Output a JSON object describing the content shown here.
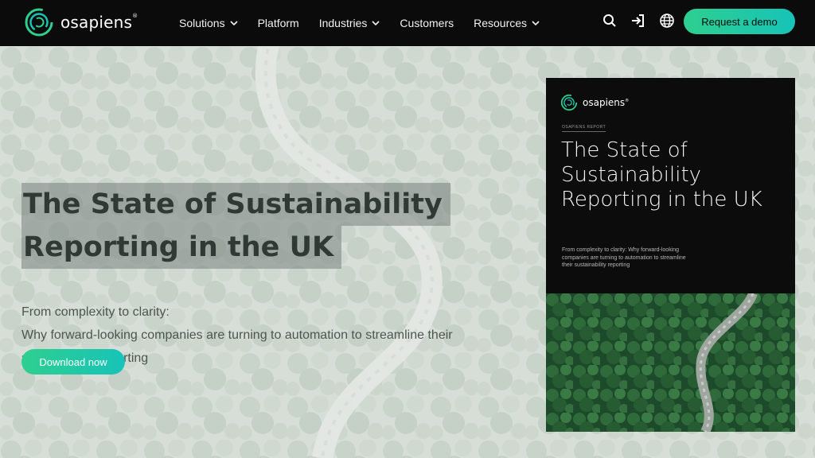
{
  "brand": {
    "name": "osapiens",
    "mark": "®",
    "accent": "#2ecf8f",
    "accent2": "#17c3b8"
  },
  "nav": {
    "items": [
      {
        "label": "Solutions",
        "has_dropdown": true
      },
      {
        "label": "Platform",
        "has_dropdown": false
      },
      {
        "label": "Industries",
        "has_dropdown": true
      },
      {
        "label": "Customers",
        "has_dropdown": false
      },
      {
        "label": "Resources",
        "has_dropdown": true
      }
    ],
    "icons": [
      "search-icon",
      "login-icon",
      "globe-icon"
    ],
    "cta_label": "Request a demo"
  },
  "hero": {
    "headline_line1": "The State of Sustainability",
    "headline_line2": "Reporting in the UK",
    "subtitle_line1": "From complexity to clarity:",
    "subtitle_line2": "Why forward-looking companies are turning to automation to streamline their sustainability reporting",
    "download_label": "Download now"
  },
  "cover": {
    "logo_text": "osapiens",
    "logo_mark": "®",
    "kicker": "OSAPIENS REPORT",
    "title": "The State of Sustainability Reporting in the UK",
    "subtitle": "From complexity to clarity: Why forward-looking companies are turning to automation to streamline their sustainability reporting"
  }
}
